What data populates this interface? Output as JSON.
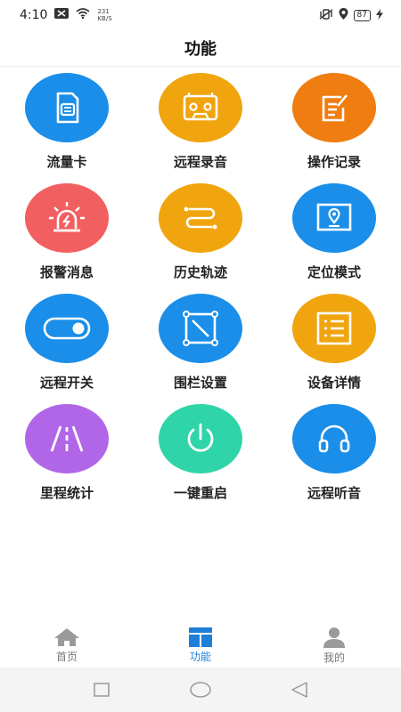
{
  "status_bar": {
    "time": "4:10",
    "net_speed_value": "231",
    "net_speed_unit": "KB/S",
    "battery": "87"
  },
  "header": {
    "title": "功能"
  },
  "features": [
    {
      "label": "流量卡",
      "icon": "sim-card-icon",
      "color": "#1a8ee8"
    },
    {
      "label": "远程录音",
      "icon": "cassette-icon",
      "color": "#f0a50f"
    },
    {
      "label": "操作记录",
      "icon": "edit-note-icon",
      "color": "#f07d10"
    },
    {
      "label": "报警消息",
      "icon": "alarm-light-icon",
      "color": "#f25f60"
    },
    {
      "label": "历史轨迹",
      "icon": "route-icon",
      "color": "#f0a50f"
    },
    {
      "label": "定位模式",
      "icon": "map-location-icon",
      "color": "#1a8ee8"
    },
    {
      "label": "远程开关",
      "icon": "toggle-icon",
      "color": "#1a8ee8"
    },
    {
      "label": "围栏设置",
      "icon": "fence-icon",
      "color": "#1a8ee8"
    },
    {
      "label": "设备详情",
      "icon": "list-details-icon",
      "color": "#f0a50f"
    },
    {
      "label": "里程统计",
      "icon": "road-icon",
      "color": "#b166e8"
    },
    {
      "label": "一键重启",
      "icon": "power-icon",
      "color": "#2fd5a8"
    },
    {
      "label": "远程听音",
      "icon": "headphones-icon",
      "color": "#1a8ee8"
    }
  ],
  "tabs": [
    {
      "label": "首页",
      "icon": "home-icon",
      "active": false
    },
    {
      "label": "功能",
      "icon": "function-grid-icon",
      "active": true
    },
    {
      "label": "我的",
      "icon": "profile-icon",
      "active": false
    }
  ],
  "colors": {
    "active_tab": "#1d7fd8",
    "inactive_tab": "#9a9a9a"
  }
}
